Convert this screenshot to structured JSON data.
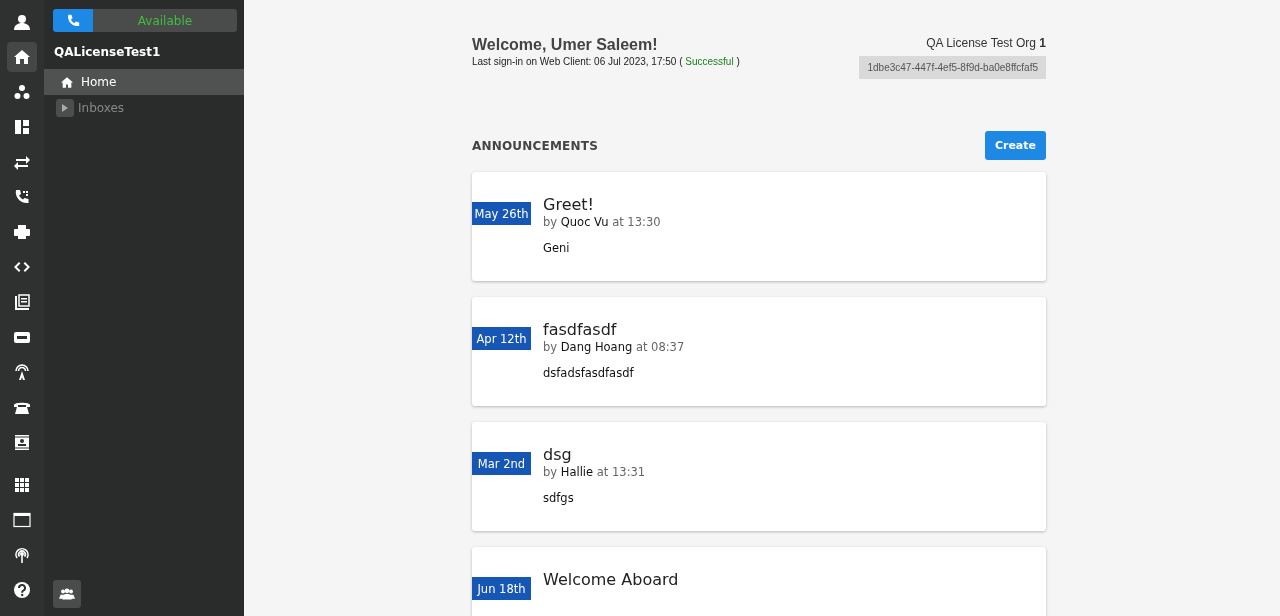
{
  "rail": [
    {
      "selected": false
    },
    {
      "selected": true
    },
    {
      "selected": false
    },
    {
      "selected": false
    },
    {
      "selected": false
    },
    {
      "selected": false
    },
    {
      "selected": false
    },
    {
      "selected": false
    },
    {
      "selected": false
    },
    {
      "selected": false
    },
    {
      "selected": false
    },
    {
      "selected": false
    },
    {
      "selected": false
    },
    {
      "selected": false
    },
    {
      "selected": false
    },
    {
      "selected": false
    },
    {
      "selected": false
    }
  ],
  "status": {
    "label": "Available"
  },
  "sidebar": {
    "title": "QALicenseTest1",
    "items": [
      {
        "label": "Home",
        "selected": true,
        "has_children": false
      },
      {
        "label": "Inboxes",
        "selected": false,
        "expanded": false,
        "has_children": true
      }
    ]
  },
  "header": {
    "welcome": "Welcome, Umer Saleem!",
    "signin_prefix": "Last sign-in on Web Client: 06 Jul 2023, 17:50 (",
    "signin_status": "Successful",
    "signin_suffix": ")",
    "org": "QA License Test Org **1**",
    "org_id": "1dbe3c47-447f-4ef5-8f9d-ba0e8ffcfaf5"
  },
  "announcements": {
    "heading": "ANNOUNCEMENTS",
    "create": "Create",
    "items": [
      {
        "date": "May 26th",
        "title": "Greet!",
        "by": "by",
        "author": "Quoc Vu",
        "at": "at 13:30",
        "body": "Geni"
      },
      {
        "date": "Apr 12th",
        "title": "fasdfasdf",
        "by": "by",
        "author": "Dang Hoang",
        "at": "at 08:37",
        "body": "dsfadsfasdfasdf"
      },
      {
        "date": "Mar 2nd",
        "title": "dsg",
        "by": "by",
        "author": "Hallie",
        "at": "at 13:31",
        "body": "sdfgs"
      },
      {
        "date": "Jun 18th",
        "title": "Welcome Aboard"
      }
    ]
  }
}
